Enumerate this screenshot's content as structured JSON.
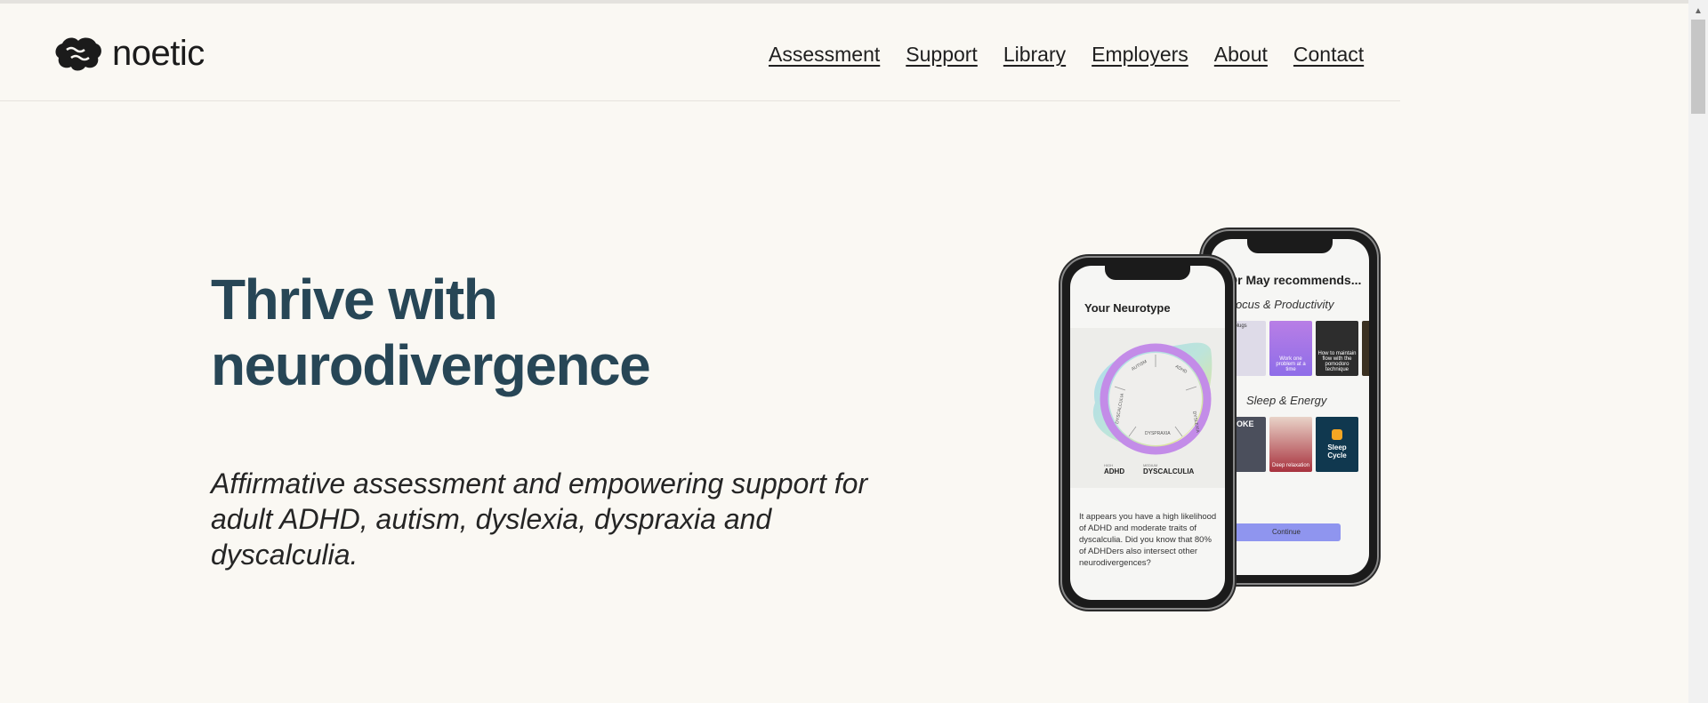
{
  "brand": {
    "name": "noetic"
  },
  "nav": {
    "items": [
      "Assessment",
      "Support",
      "Library",
      "Employers",
      "About",
      "Contact"
    ]
  },
  "hero": {
    "title_line1": "Thrive with",
    "title_line2": "neurodivergence",
    "subtitle": "Affirmative assessment and empowering support for adult ADHD, autism, dyslexia, dyspraxia and dyscalculia."
  },
  "phone_back": {
    "heading": "Dr May recommends...",
    "category1": "Focus & Productivity",
    "category2": "Sleep & Energy",
    "thumb_labels": [
      "Earplugs",
      "Work one problem at a time",
      "How to maintain flow with the pomodoro technique",
      "",
      "SPOKE",
      "Deep relaxation",
      "Sleep Cycle"
    ],
    "continue_label": "Continue"
  },
  "phone_front": {
    "heading": "Your Neurotype",
    "wheel_labels": [
      "AUTISM",
      "ADHD",
      "DYSLEXIA",
      "DYSPRAXIA",
      "DYSCALCULIA"
    ],
    "result_small_1": "HIGH",
    "result_1": "ADHD",
    "result_small_2": "MEDIUM",
    "result_2": "DYSCALCULIA",
    "body": "It appears you have a high likelihood of ADHD and moderate traits of dyscalculia. Did you know that 80% of ADHDers also intersect other neurodivergences?"
  },
  "colors": {
    "background": "#faf8f3",
    "title": "#274656",
    "button": "#8f95ef"
  }
}
